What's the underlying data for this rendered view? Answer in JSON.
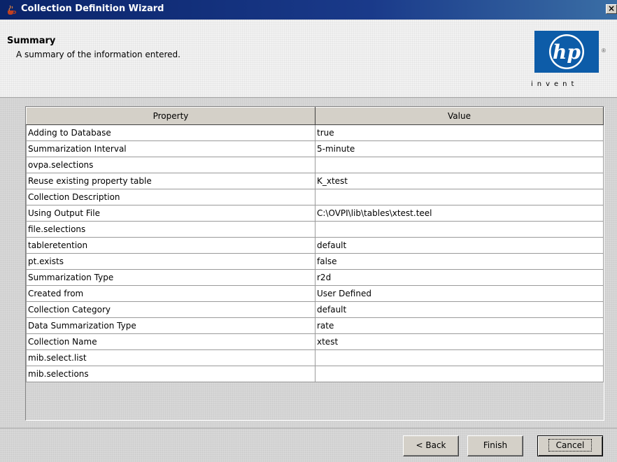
{
  "window": {
    "title": "Collection Definition Wizard",
    "close_glyph": "×"
  },
  "header": {
    "title": "Summary",
    "subtitle": "A summary of the information entered.",
    "logo_text": "hp",
    "tagline": "invent",
    "registered_mark": "®"
  },
  "table": {
    "columns": [
      "Property",
      "Value"
    ],
    "rows": [
      {
        "property": "Adding to Database",
        "value": "true"
      },
      {
        "property": "Summarization Interval",
        "value": "5-minute"
      },
      {
        "property": "ovpa.selections",
        "value": ""
      },
      {
        "property": "Reuse existing property table",
        "value": "K_xtest"
      },
      {
        "property": "Collection Description",
        "value": ""
      },
      {
        "property": "Using Output File",
        "value": "C:\\OVPI\\lib\\tables\\xtest.teel"
      },
      {
        "property": "file.selections",
        "value": ""
      },
      {
        "property": "tableretention",
        "value": "default"
      },
      {
        "property": "pt.exists",
        "value": "false"
      },
      {
        "property": "Summarization Type",
        "value": "r2d"
      },
      {
        "property": "Created from",
        "value": "User Defined"
      },
      {
        "property": "Collection Category",
        "value": "default"
      },
      {
        "property": "Data Summarization Type",
        "value": "rate"
      },
      {
        "property": "Collection Name",
        "value": "xtest"
      },
      {
        "property": "mib.select.list",
        "value": ""
      },
      {
        "property": "mib.selections",
        "value": ""
      }
    ]
  },
  "buttons": {
    "back": "< Back",
    "finish": "Finish",
    "cancel": "Cancel"
  },
  "colors": {
    "titlebar": "#0a246a",
    "hp_blue": "#0d5ca8"
  }
}
